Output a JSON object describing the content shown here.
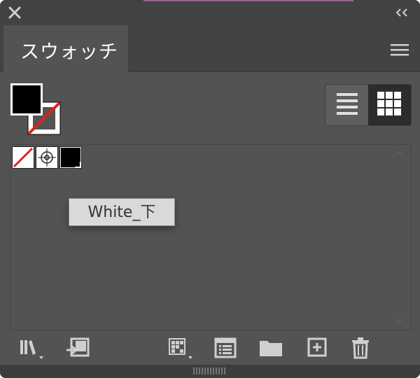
{
  "panel": {
    "tab_label": "スウォッチ",
    "tooltip": "White_下"
  },
  "icons": {
    "close": "close-icon",
    "collapse": "collapse-double-chevron-icon",
    "panel_menu": "hamburger-menu-icon",
    "list_view": "list-view-icon",
    "grid_view": "grid-view-icon",
    "libraries": "libraries-menu-icon",
    "import_swatch": "import-swatch-icon",
    "show_kinds": "show-swatch-kinds-icon",
    "swatch_options": "swatch-options-icon",
    "new_group": "new-color-group-folder-icon",
    "new_swatch": "new-swatch-icon",
    "delete": "trash-icon"
  },
  "swatches": [
    {
      "kind": "none",
      "name": "none-swatch"
    },
    {
      "kind": "registration",
      "name": "registration-swatch"
    },
    {
      "kind": "black",
      "name": "black-swatch"
    }
  ],
  "fill_stroke": {
    "fill": "#000000",
    "stroke": "none"
  },
  "view_mode": "grid",
  "colors": {
    "panel_bg": "#535353",
    "header_bg": "#434343",
    "tooltip_bg": "#d9d9d9",
    "none_red": "#e02020",
    "accent_pink": "#a15aa0"
  }
}
